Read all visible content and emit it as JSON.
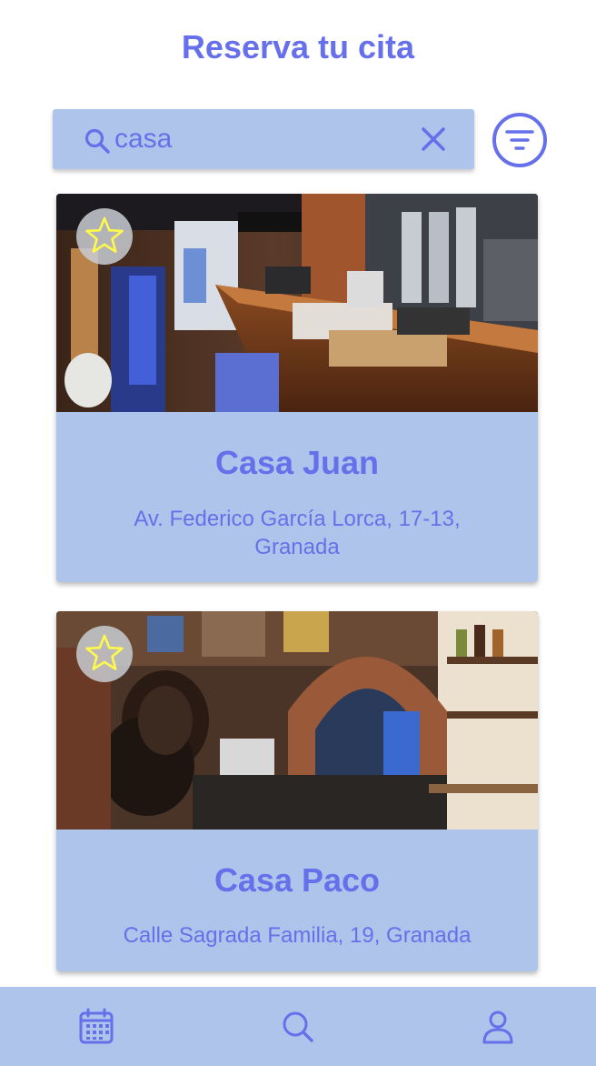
{
  "header": {
    "title": "Reserva tu cita"
  },
  "search": {
    "value": "casa",
    "icon": "search-icon",
    "clear_icon": "close-icon"
  },
  "filter": {
    "icon": "filter-icon"
  },
  "results": [
    {
      "name": "Casa Juan",
      "address": "Av. Federico García Lorca, 17-13, Granada",
      "favorite_icon": "star-icon"
    },
    {
      "name": "Casa Paco",
      "address": "Calle Sagrada Familia, 19, Granada",
      "favorite_icon": "star-icon"
    }
  ],
  "bottom_nav": {
    "items": [
      {
        "icon": "calendar-icon"
      },
      {
        "icon": "search-icon"
      },
      {
        "icon": "user-icon"
      }
    ]
  },
  "colors": {
    "accent": "#6670ea",
    "surface": "#aec4ea",
    "star": "#fff94a"
  }
}
